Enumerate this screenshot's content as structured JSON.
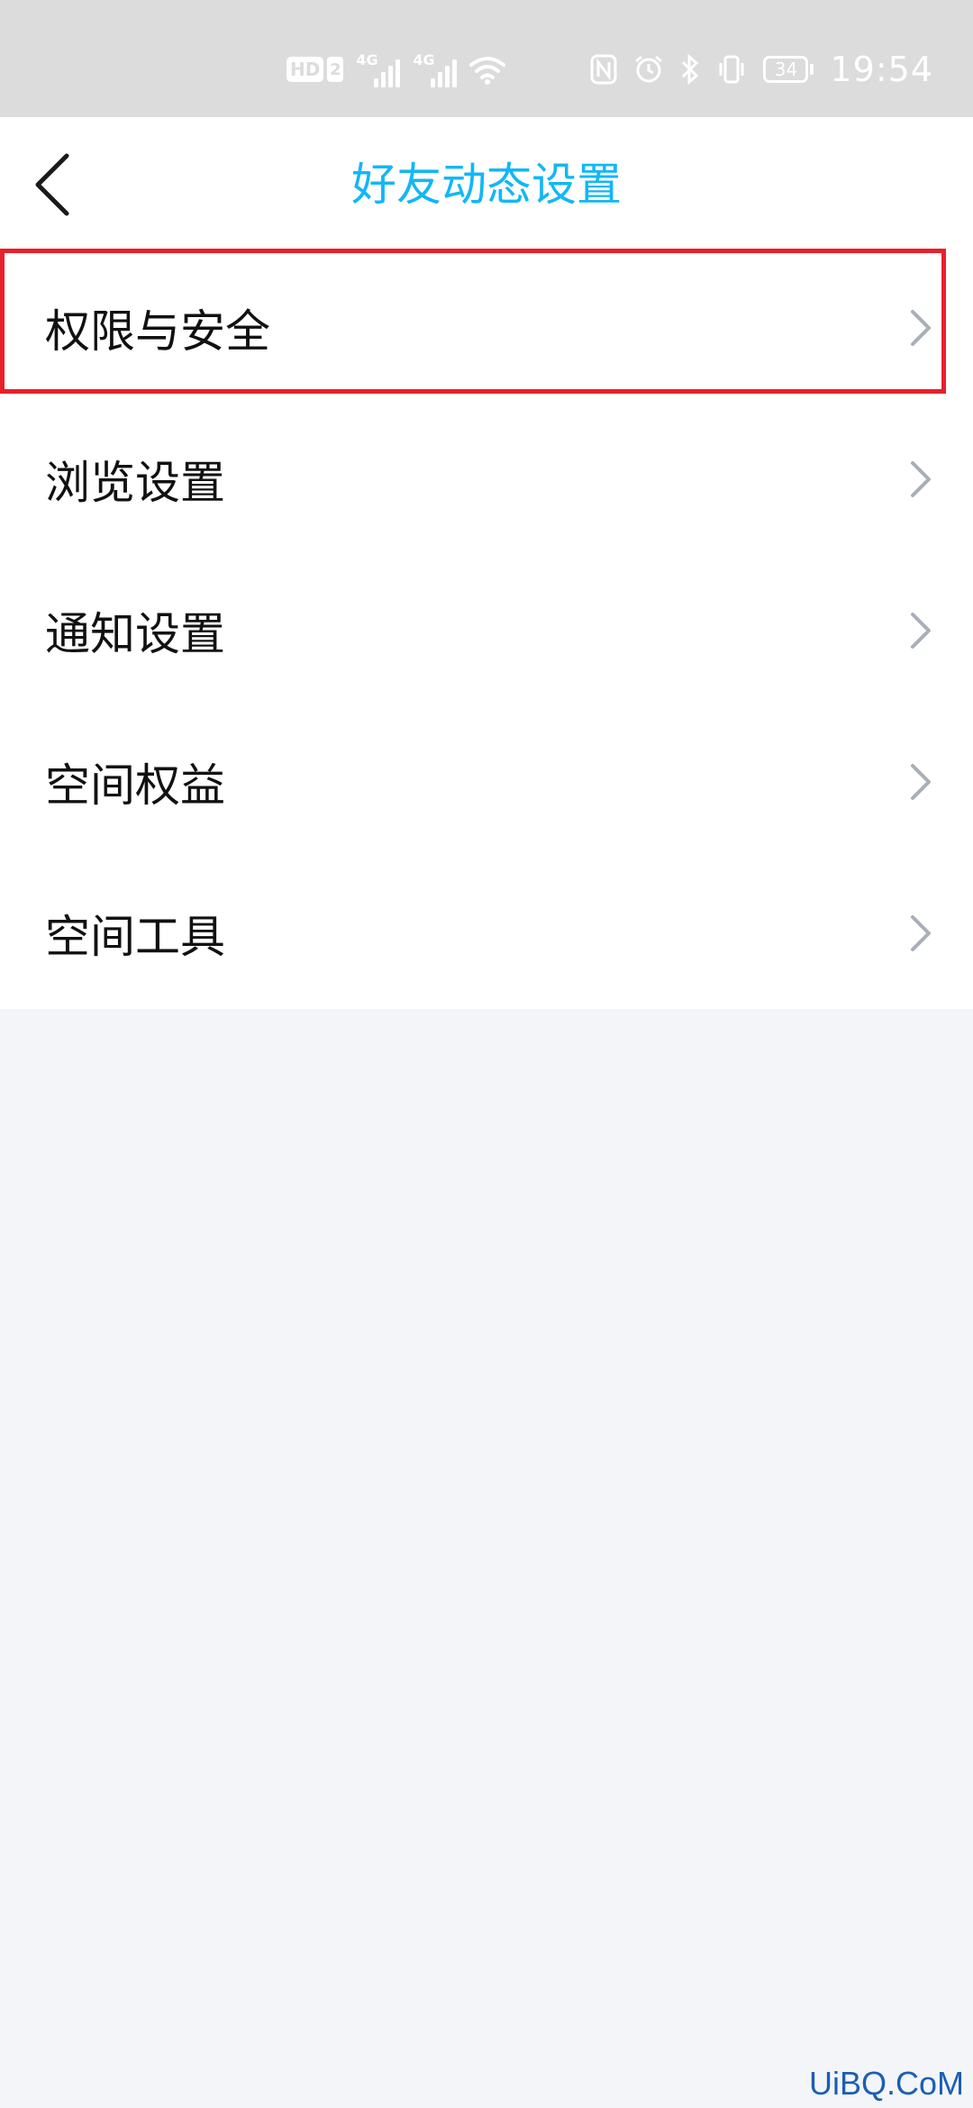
{
  "status_bar": {
    "time": "19:54",
    "hd_label": "HD",
    "sim_label": "2",
    "network_1": "4G",
    "network_2": "4G",
    "battery_level": "34",
    "icons": [
      "hd-icon",
      "signal-icon",
      "signal-icon",
      "wifi-icon",
      "nfc-icon",
      "alarm-icon",
      "bluetooth-icon",
      "vibrate-icon",
      "battery-icon"
    ]
  },
  "header": {
    "title": "好友动态设置",
    "back_icon": "chevron-left-icon",
    "title_color": "#12b7f5"
  },
  "menu": {
    "items": [
      {
        "label": "权限与安全"
      },
      {
        "label": "浏览设置"
      },
      {
        "label": "通知设置"
      },
      {
        "label": "空间权益"
      },
      {
        "label": "空间工具"
      }
    ],
    "chevron_icon": "chevron-right-icon"
  },
  "highlight": {
    "target": "权限与安全",
    "color": "#e8202a"
  },
  "watermark": {
    "text": "UiBQ.CoM"
  }
}
